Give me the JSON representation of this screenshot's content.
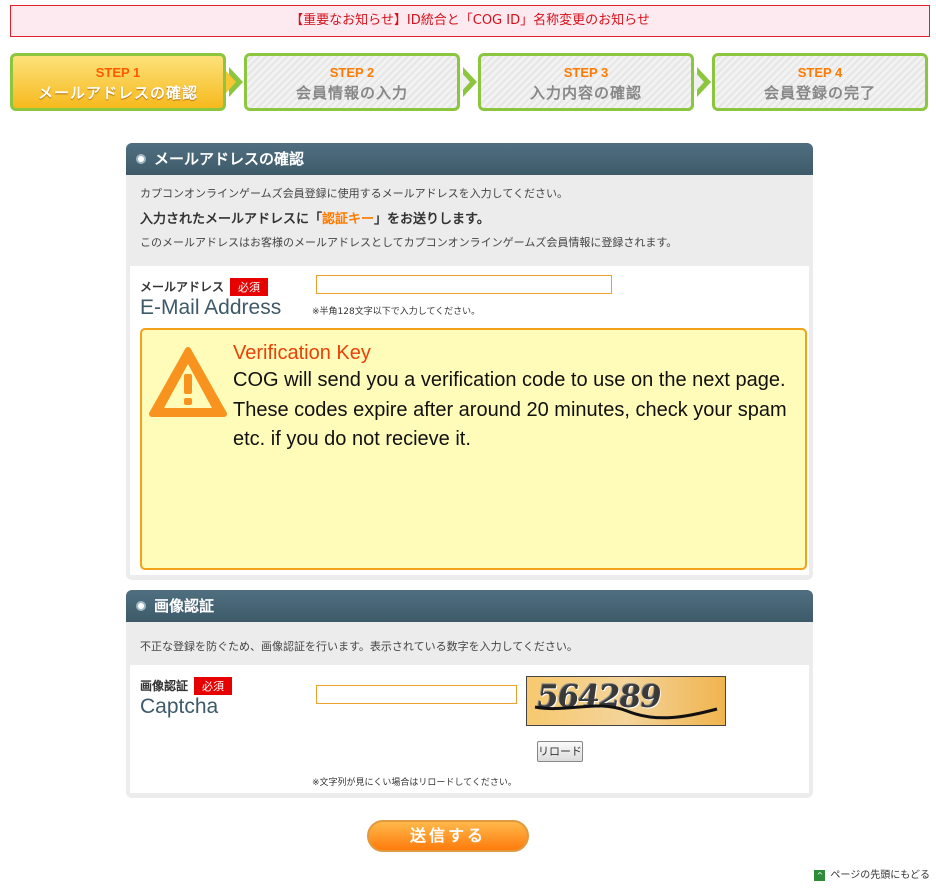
{
  "notice": {
    "text": "【重要なお知らせ】ID統合と「COG ID」名称変更のお知らせ"
  },
  "steps": [
    {
      "num": "STEP 1",
      "label": "メールアドレスの確認"
    },
    {
      "num": "STEP 2",
      "label": "会員情報の入力"
    },
    {
      "num": "STEP 3",
      "label": "入力内容の確認"
    },
    {
      "num": "STEP 4",
      "label": "会員登録の完了"
    }
  ],
  "email_section": {
    "title": "メールアドレスの確認",
    "intro_line1": "カプコンオンラインゲームズ会員登録に使用するメールアドレスを入力してください。",
    "intro_line2_prefix": "入力されたメールアドレスに「",
    "intro_line2_key": "認証キー",
    "intro_line2_suffix": "」をお送りします。",
    "intro_line3": "このメールアドレスはお客様のメールアドレスとしてカプコンオンラインゲームズ会員情報に登録されます。",
    "field_label_jp": "メールアドレス",
    "required": "必須",
    "field_label_en": "E-Mail Address",
    "email_value": "",
    "note": "※半角128文字以下で入力してください。"
  },
  "warning": {
    "title": "Verification Key",
    "body": "COG will send you a verification code to use on the next page. These codes expire after around 20 minutes, check your spam etc. if you do not recieve it."
  },
  "captcha_section": {
    "title": "画像認証",
    "intro": "不正な登録を防ぐため、画像認証を行います。表示されている数字を入力してください。",
    "field_label_jp": "画像認証",
    "required": "必須",
    "field_label_en": "Captcha",
    "captcha_value": "",
    "captcha_text": "564289",
    "reload_label": "リロード",
    "note": "※文字列が見にくい場合はリロードしてください。"
  },
  "submit_label": "送信する",
  "page_top_label": "ページの先頭にもどる",
  "colors": {
    "accent": "#ff7a00",
    "step_border": "#8cc63f",
    "panel_head": "#3e5a69",
    "required": "#e60000"
  }
}
